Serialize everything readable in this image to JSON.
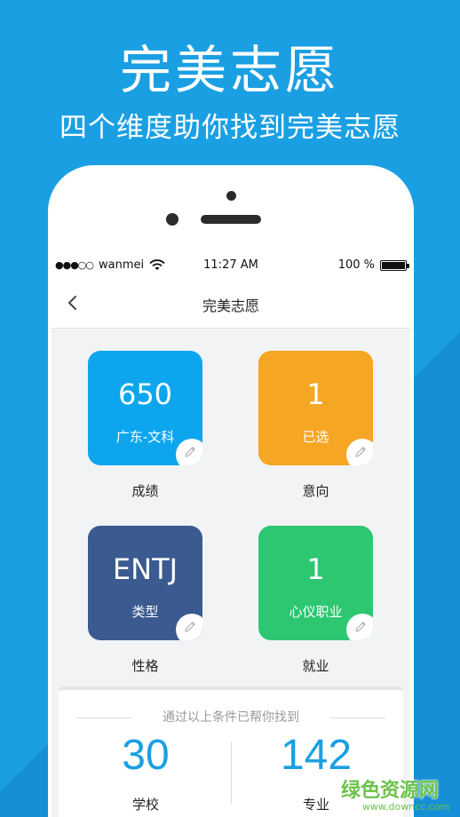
{
  "header": {
    "title": "完美志愿",
    "subtitle": "四个维度助你找到完美志愿"
  },
  "status_bar": {
    "signal": "●●●○○",
    "carrier": "wanmei",
    "time": "11:27 AM",
    "battery": "100 %"
  },
  "nav": {
    "title": "完美志愿",
    "back_icon": "chevron-left-icon"
  },
  "cards": [
    {
      "value": "650",
      "sub": "广东-文科",
      "label": "成绩",
      "color": "#0da6ee"
    },
    {
      "value": "1",
      "sub": "已选",
      "label": "意向",
      "color": "#f5a623"
    },
    {
      "value": "ENTJ",
      "sub": "类型",
      "label": "性格",
      "color": "#3b5a8f"
    },
    {
      "value": "1",
      "sub": "心仪职业",
      "label": "就业",
      "color": "#2dc771"
    }
  ],
  "result": {
    "caption": "通过以上条件已帮你找到",
    "schools_value": "30",
    "schools_label": "学校",
    "majors_value": "142",
    "majors_label": "专业"
  },
  "watermark": {
    "text": "绿色资源网",
    "url": "www.downcc.com"
  },
  "colors": {
    "background": "#1a9fe3",
    "accent": "#1a9fe3"
  }
}
